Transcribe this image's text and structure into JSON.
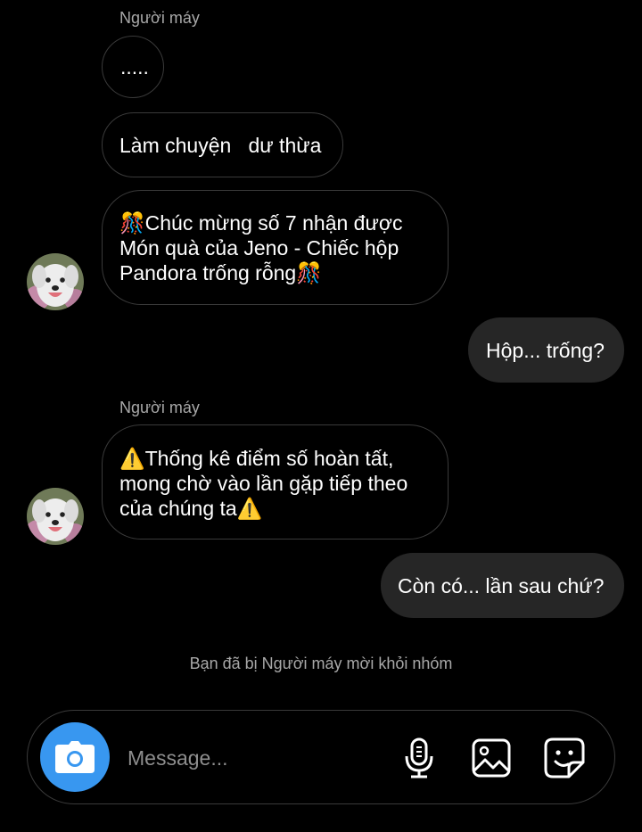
{
  "thread": {
    "messages": [
      {
        "sender": "Người máy",
        "text": "....."
      },
      {
        "text": "Làm chuyện   dư thừa"
      },
      {
        "lines": [
          "🎊Chúc mừng số 7 nhận được",
          "Món quà của Jeno - Chiếc hộp",
          "Pandora trống rỗng🎊"
        ]
      },
      {
        "text": "Hộp... trống?"
      },
      {
        "sender": "Người máy",
        "lines": [
          "⚠️Thống kê điểm số hoàn tất,",
          "mong chờ vào lần gặp tiếp theo",
          "của chúng ta⚠️"
        ]
      },
      {
        "text": "Còn có... lần sau chứ?"
      }
    ],
    "system_note": "Bạn đã bị Người máy mời khỏi nhóm"
  },
  "composer": {
    "placeholder": "Message...",
    "icons": {
      "camera": "camera-icon",
      "mic": "microphone-icon",
      "gallery": "image-icon",
      "sticker": "sticker-icon"
    }
  },
  "colors": {
    "background": "#000000",
    "outgoing_bubble": "#262626",
    "incoming_border": "#3a3a3a",
    "secondary_text": "#a8a8a8",
    "accent": "#3897f0"
  }
}
